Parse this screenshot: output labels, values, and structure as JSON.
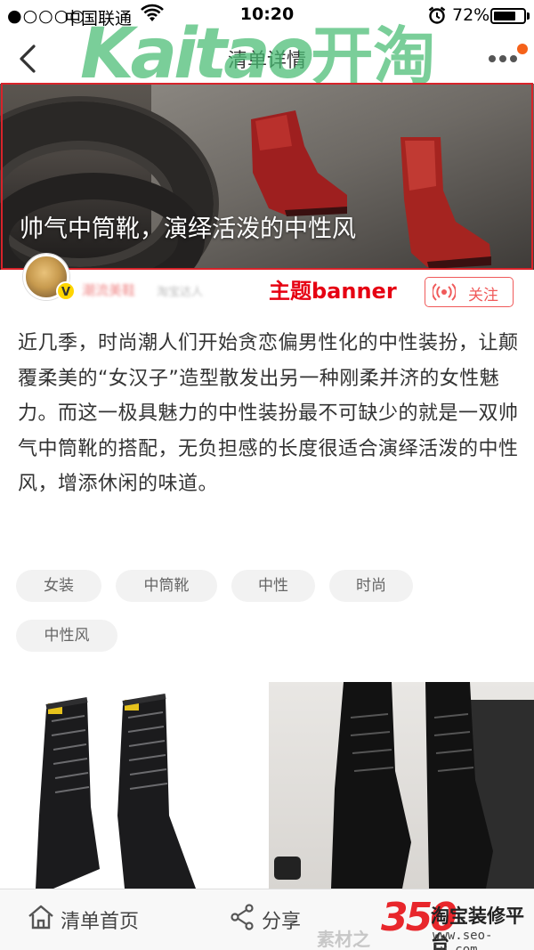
{
  "status_bar": {
    "signal": "●○○○○",
    "carrier": "中国联通",
    "time": "10:20",
    "battery_pct": "72%",
    "icons": [
      "signal-dots-icon",
      "wifi-icon",
      "alarm-icon",
      "battery-icon"
    ]
  },
  "nav": {
    "title": "清单详情",
    "back_icon": "chevron-left-icon",
    "more_icon": "ellipsis-icon",
    "notification_dot_color": "#f5621a"
  },
  "watermark_top": {
    "latin": "Kaitao",
    "cn": "开淘",
    "color": "#47bb71"
  },
  "banner": {
    "title": "帅气中筒靴，演绎活泼的中性风",
    "outline_color": "#d8232a"
  },
  "author": {
    "name": "潮流美鞋",
    "role": "淘宝达人",
    "badge": "V"
  },
  "annotation": "主题banner",
  "follow": {
    "label": "关注",
    "icon": "broadcast-icon",
    "color": "#f05a5a"
  },
  "description": "近几季，时尚潮人们开始贪恋偏男性化的中性装扮，让颠覆柔美的“女汉子”造型散发出另一种刚柔并济的女性魅力。而这一极具魅力的中性装扮最不可缺少的就是一双帅气中筒靴的搭配，无负担感的长度很适合演绎活泼的中性风，增添休闲的味道。",
  "tags": [
    "女装",
    "中筒靴",
    "中性",
    "时尚",
    "中性风"
  ],
  "bottom_bar": {
    "home_label": "清单首页",
    "home_icon": "home-icon",
    "share_label": "分享",
    "share_icon": "share-icon"
  },
  "watermark_bottom": {
    "sucai": "素材之",
    "num": "350",
    "platform": "淘宝装修平台",
    "url": "www.seo-lv.com"
  }
}
